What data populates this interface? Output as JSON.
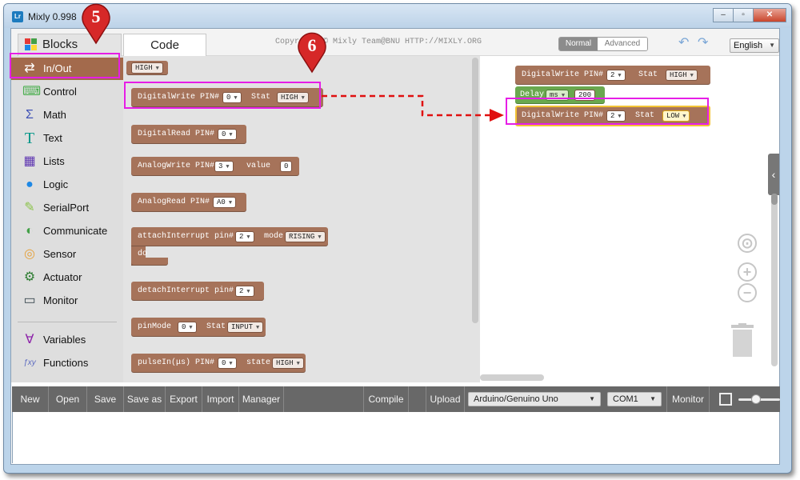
{
  "window": {
    "title": "Mixly 0.998",
    "app_icon_text": "Lr"
  },
  "header": {
    "tab_blocks": "Blocks",
    "tab_code": "Code",
    "copyright": "Copyright © Mixly Team@BNU HTTP://MIXLY.ORG",
    "mode_normal": "Normal",
    "mode_advanced": "Advanced",
    "language": "English"
  },
  "toolbox": {
    "items": [
      {
        "label": "In/Out",
        "icon": "in-out-icon",
        "color": "#ffffff"
      },
      {
        "label": "Control",
        "icon": "gamepad-icon",
        "color": "#4caf50"
      },
      {
        "label": "Math",
        "icon": "math-icon",
        "color": "#3f51b5"
      },
      {
        "label": "Text",
        "icon": "text-icon",
        "color": "#009688"
      },
      {
        "label": "Lists",
        "icon": "lists-icon",
        "color": "#5e35b1"
      },
      {
        "label": "Logic",
        "icon": "bulb-icon",
        "color": "#1e88e5"
      },
      {
        "label": "SerialPort",
        "icon": "serial-icon",
        "color": "#8bc34a"
      },
      {
        "label": "Communicate",
        "icon": "satellite-icon",
        "color": "#43a047"
      },
      {
        "label": "Sensor",
        "icon": "sensor-icon",
        "color": "#e6a23c"
      },
      {
        "label": "Actuator",
        "icon": "actuator-icon",
        "color": "#2e7d32"
      },
      {
        "label": "Monitor",
        "icon": "monitor-icon",
        "color": "#37474f"
      },
      {
        "label": "Variables",
        "icon": "variables-icon",
        "color": "#8e24aa"
      },
      {
        "label": "Functions",
        "icon": "functions-icon",
        "color": "#5c6bc0"
      }
    ]
  },
  "flyout": {
    "high_block": "HIGH",
    "digitalwrite": {
      "label": "DigitalWrite PIN#",
      "pin": "0",
      "stat_label": "Stat",
      "stat": "HIGH"
    },
    "digitalread": {
      "label": "DigitalRead PIN#",
      "pin": "0"
    },
    "analogwrite": {
      "label": "AnalogWrite PIN#",
      "pin": "3",
      "value_label": "value",
      "value": "0"
    },
    "analogread": {
      "label": "AnalogRead PIN#",
      "pin": "A0"
    },
    "attachinterrupt": {
      "label": "attachInterrupt pin#",
      "pin": "2",
      "mode_label": "mode",
      "mode": "RISING",
      "do_label": "do"
    },
    "detachinterrupt": {
      "label": "detachInterrupt pin#",
      "pin": "2"
    },
    "pinmode": {
      "label": "pinMode",
      "pin": "0",
      "stat_label": "Stat",
      "stat": "INPUT"
    },
    "pulsein": {
      "label": "pulseIn(μs) PIN#",
      "pin": "0",
      "state_label": "state",
      "state": "HIGH"
    }
  },
  "workspace": {
    "block1": {
      "label": "DigitalWrite PIN#",
      "pin": "2",
      "stat_label": "Stat",
      "stat": "HIGH"
    },
    "delay": {
      "label": "Delay",
      "unit": "ms",
      "value": "200"
    },
    "block2": {
      "label": "DigitalWrite PIN#",
      "pin": "2",
      "stat_label": "Stat",
      "stat": "LOW"
    }
  },
  "bottom_bar": {
    "new": "New",
    "open": "Open",
    "save": "Save",
    "save_as": "Save as",
    "export": "Export",
    "import": "Import",
    "manager": "Manager",
    "compile": "Compile",
    "upload": "Upload",
    "board": "Arduino/Genuino Uno",
    "port": "COM1",
    "monitor": "Monitor"
  },
  "annotations": {
    "marker5": "5",
    "marker6": "6"
  },
  "colors": {
    "highlight": "#e61ee6",
    "marker": "#d62828",
    "arrow": "#e01010",
    "io_block": "#a6735a",
    "delay_block": "#6aa84f"
  }
}
